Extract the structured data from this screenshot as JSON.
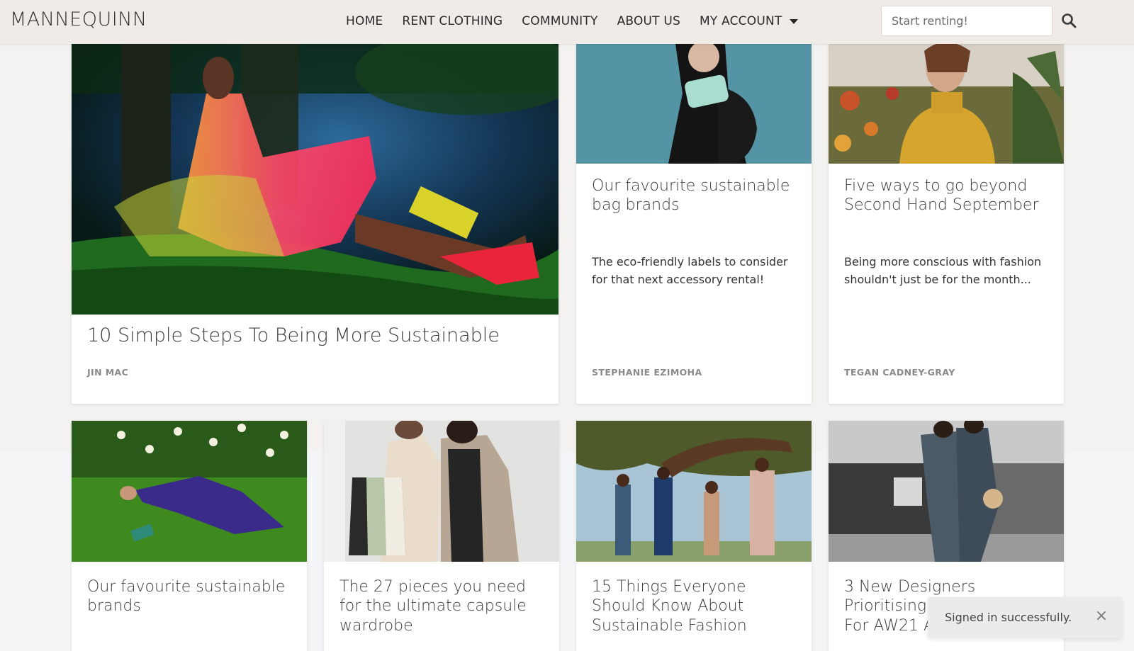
{
  "navbar": {
    "brand": "MANNEQUINN",
    "links": [
      "HOME",
      "RENT CLOTHING",
      "COMMUNITY",
      "ABOUT US",
      "MY ACCOUNT"
    ],
    "search_placeholder": "Start renting!",
    "search_icon": "search-icon",
    "account_icon": "caret-down-icon"
  },
  "articles": [
    {
      "title": "10 Simple Steps To Being More Sustainable",
      "excerpt": "",
      "author": "JIN MAC",
      "image": "woman in pink tulle dress sitting under tree by lake"
    },
    {
      "title": "Our favourite sustainable bag brands",
      "excerpt": "The eco-friendly labels to consider for that next accessory rental!",
      "author": "STEPHANIE EZIMOHA",
      "image": "woman in black dress holding mint clutch bag"
    },
    {
      "title": "Five ways to go beyond Second Hand September",
      "excerpt": "Being more conscious with fashion shouldn't just be for the month...",
      "author": "TEGAN CADNEY-GRAY",
      "image": "smiling woman in mustard turtleneck among flowers"
    },
    {
      "title": "Our favourite sustainable brands",
      "image": "woman in purple dress lying on grass among daffodils"
    },
    {
      "title": "The 27 pieces you need for the ultimate capsule wardrobe",
      "image": "two women in neutral coats with tote bag"
    },
    {
      "title": "15 Things Everyone Should Know About Sustainable Fashion",
      "image": "group of women posing under a large tree"
    },
    {
      "title": "3 New Designers Prioritising E",
      "title_line3": "For AW21 A",
      "image": "two models in checked suits on a street"
    }
  ],
  "toast": {
    "message": "Signed in successfully.",
    "close_symbol": "×"
  },
  "colors": {
    "navbar_bg": "#f1ebe8",
    "page_bg": "#f4f2f0",
    "card_bg": "#ffffff",
    "author_text": "#8a8a8a"
  }
}
